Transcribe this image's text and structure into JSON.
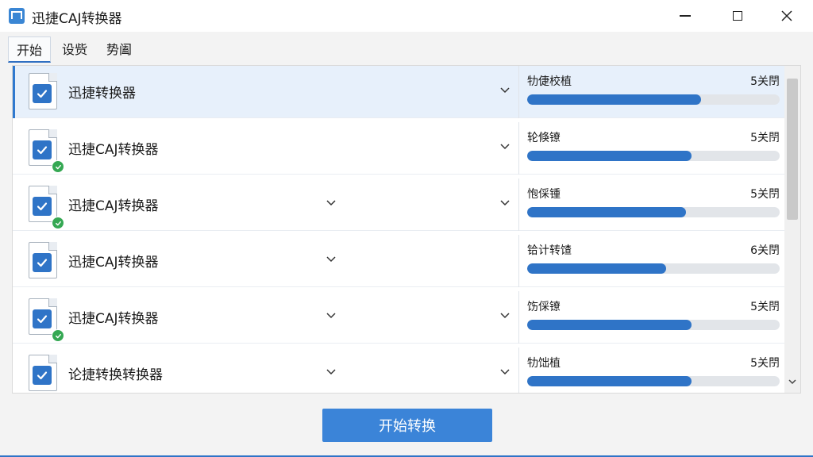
{
  "window": {
    "title": "迅捷CAJ转换器"
  },
  "tabs": [
    {
      "label": "开始",
      "active": true
    },
    {
      "label": "设赀",
      "active": false
    },
    {
      "label": "势阖",
      "active": false
    }
  ],
  "rows": [
    {
      "name": "迅捷转换器",
      "status_label": "牞倢校植",
      "count": "5关閅",
      "progress": 0.69,
      "done": false,
      "selected": true,
      "second_chevron": false
    },
    {
      "name": "迅捷CAJ转换器",
      "status_label": "轮倏镣",
      "count": "5关閅",
      "progress": 0.65,
      "done": true,
      "selected": false,
      "second_chevron": false
    },
    {
      "name": "迅捷CAJ转换器",
      "status_label": "怉倸锺",
      "count": "5关閅",
      "progress": 0.63,
      "done": true,
      "selected": false,
      "second_chevron": true
    },
    {
      "name": "迅捷CAJ转换器",
      "status_label": "铪计转馇",
      "count": "6关閅",
      "progress": 0.55,
      "done": false,
      "selected": false,
      "second_chevron": true
    },
    {
      "name": "迅捷CAJ转换器",
      "status_label": "饬倸镣",
      "count": "5关閅",
      "progress": 0.65,
      "done": true,
      "selected": false,
      "second_chevron": true
    },
    {
      "name": "论捷转换转换器",
      "status_label": "牞饳植",
      "count": "5关閅",
      "progress": 0.65,
      "done": false,
      "selected": false,
      "second_chevron": true
    }
  ],
  "actions": {
    "start_label": "开始转换"
  },
  "colors": {
    "accent": "#2f74c7",
    "button": "#3b84d8",
    "success": "#35a853"
  }
}
